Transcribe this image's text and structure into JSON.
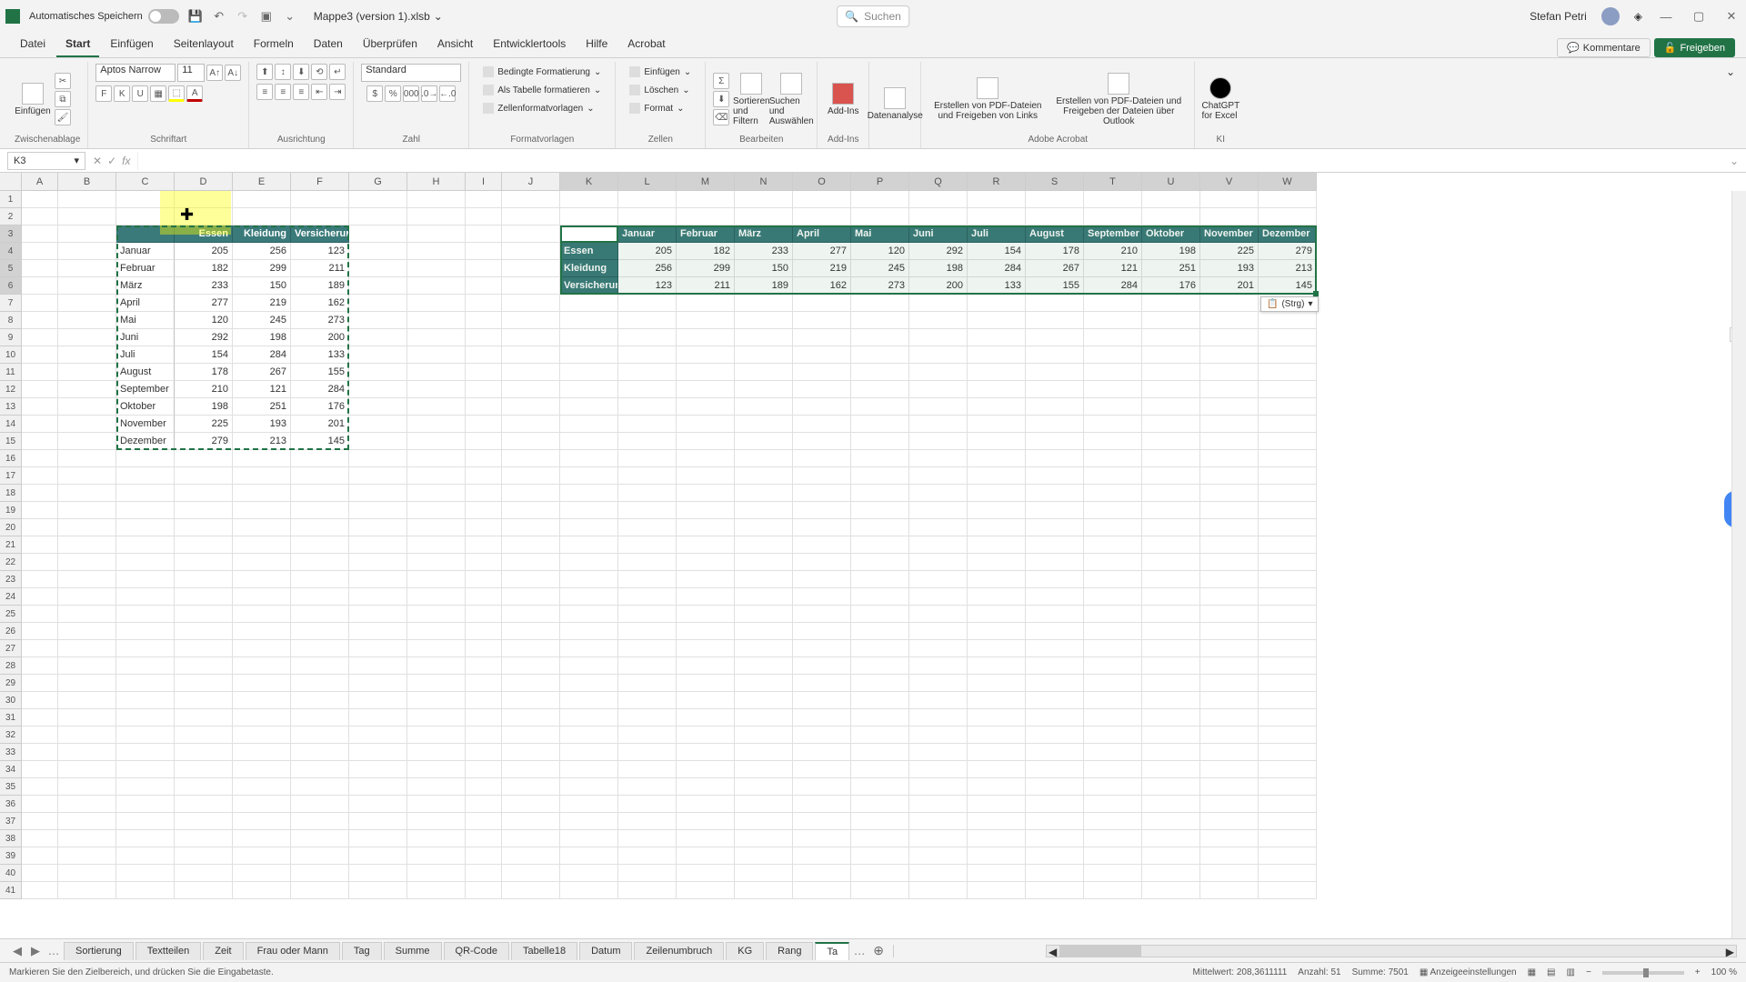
{
  "titlebar": {
    "autosave_label": "Automatisches Speichern",
    "file_title": "Mappe3 (version 1).xlsb",
    "search_placeholder": "Suchen",
    "user_name": "Stefan Petri"
  },
  "tabs": {
    "items": [
      "Datei",
      "Start",
      "Einfügen",
      "Seitenlayout",
      "Formeln",
      "Daten",
      "Überprüfen",
      "Ansicht",
      "Entwicklertools",
      "Hilfe",
      "Acrobat"
    ],
    "active": "Start",
    "comments": "Kommentare",
    "share": "Freigeben"
  },
  "ribbon": {
    "clipboard": {
      "paste": "Einfügen",
      "label": "Zwischenablage"
    },
    "font": {
      "name": "Aptos Narrow",
      "size": "11",
      "bold": "F",
      "italic": "K",
      "underline": "U",
      "label": "Schriftart"
    },
    "align": {
      "label": "Ausrichtung"
    },
    "number": {
      "format": "Standard",
      "label": "Zahl"
    },
    "styles": {
      "cond": "Bedingte Formatierung",
      "table": "Als Tabelle formatieren",
      "cell": "Zellenformatvorlagen",
      "label": "Formatvorlagen"
    },
    "cells": {
      "insert": "Einfügen",
      "delete": "Löschen",
      "format": "Format",
      "label": "Zellen"
    },
    "editing": {
      "sort": "Sortieren und Filtern",
      "find": "Suchen und Auswählen",
      "label": "Bearbeiten"
    },
    "addins": {
      "btn": "Add-Ins",
      "label": "Add-Ins"
    },
    "analysis": {
      "btn": "Datenanalyse"
    },
    "acrobat": {
      "btn1": "Erstellen von PDF-Dateien und Freigeben von Links",
      "btn2": "Erstellen von PDF-Dateien und Freigeben der Dateien über Outlook",
      "label": "Adobe Acrobat"
    },
    "ki": {
      "btn": "ChatGPT for Excel",
      "label": "KI"
    }
  },
  "fx": {
    "name_box": "K3"
  },
  "cols": [
    "A",
    "B",
    "C",
    "D",
    "E",
    "F",
    "G",
    "H",
    "I",
    "J",
    "K",
    "L",
    "M",
    "N",
    "O",
    "P",
    "Q",
    "R",
    "S",
    "T",
    "U",
    "V",
    "W"
  ],
  "rows": [
    1,
    2,
    3,
    4,
    5,
    6,
    7,
    8,
    9,
    10,
    11,
    12,
    13,
    14,
    15,
    16,
    17,
    18,
    19,
    20,
    21,
    22,
    23,
    24,
    25,
    26,
    27,
    28,
    29,
    30,
    31,
    32,
    33,
    34,
    35,
    36,
    37,
    38,
    39,
    40,
    41
  ],
  "vertical_table": {
    "headers": [
      "Essen",
      "Kleidung",
      "Versicherung"
    ],
    "rows": [
      {
        "m": "Januar",
        "v": [
          205,
          256,
          123
        ]
      },
      {
        "m": "Februar",
        "v": [
          182,
          299,
          211
        ]
      },
      {
        "m": "März",
        "v": [
          233,
          150,
          189
        ]
      },
      {
        "m": "April",
        "v": [
          277,
          219,
          162
        ]
      },
      {
        "m": "Mai",
        "v": [
          120,
          245,
          273
        ]
      },
      {
        "m": "Juni",
        "v": [
          292,
          198,
          200
        ]
      },
      {
        "m": "Juli",
        "v": [
          154,
          284,
          133
        ]
      },
      {
        "m": "August",
        "v": [
          178,
          267,
          155
        ]
      },
      {
        "m": "September",
        "v": [
          210,
          121,
          284
        ]
      },
      {
        "m": "Oktober",
        "v": [
          198,
          251,
          176
        ]
      },
      {
        "m": "November",
        "v": [
          225,
          193,
          201
        ]
      },
      {
        "m": "Dezember",
        "v": [
          279,
          213,
          145
        ]
      }
    ]
  },
  "horizontal_table": {
    "col_headers": [
      "Januar",
      "Februar",
      "März",
      "April",
      "Mai",
      "Juni",
      "Juli",
      "August",
      "September",
      "Oktober",
      "November",
      "Dezember"
    ],
    "rows": [
      {
        "lbl": "Essen",
        "v": [
          205,
          182,
          233,
          277,
          120,
          292,
          154,
          178,
          210,
          198,
          225,
          279
        ]
      },
      {
        "lbl": "Kleidung",
        "v": [
          256,
          299,
          150,
          219,
          245,
          198,
          284,
          267,
          121,
          251,
          193,
          213
        ]
      },
      {
        "lbl": "Versicherung",
        "v": [
          123,
          211,
          189,
          162,
          273,
          200,
          133,
          155,
          284,
          176,
          201,
          145
        ]
      }
    ]
  },
  "paste_tag": "(Strg)",
  "sheets": {
    "tabs": [
      "Sortierung",
      "Textteilen",
      "Zeit",
      "Frau oder Mann",
      "Tag",
      "Summe",
      "QR-Code",
      "Tabelle18",
      "Datum",
      "Zeilenumbruch",
      "KG",
      "Rang",
      "Ta"
    ],
    "active": "Ta",
    "ellipsis": "…"
  },
  "status": {
    "hint": "Markieren Sie den Zielbereich, und drücken Sie die Eingabetaste.",
    "mean_lbl": "Mittelwert:",
    "mean": "208,3611111",
    "count_lbl": "Anzahl:",
    "count": "51",
    "sum_lbl": "Summe:",
    "sum": "7501",
    "display": "Anzeigeeinstellungen",
    "zoom": "100 %"
  }
}
